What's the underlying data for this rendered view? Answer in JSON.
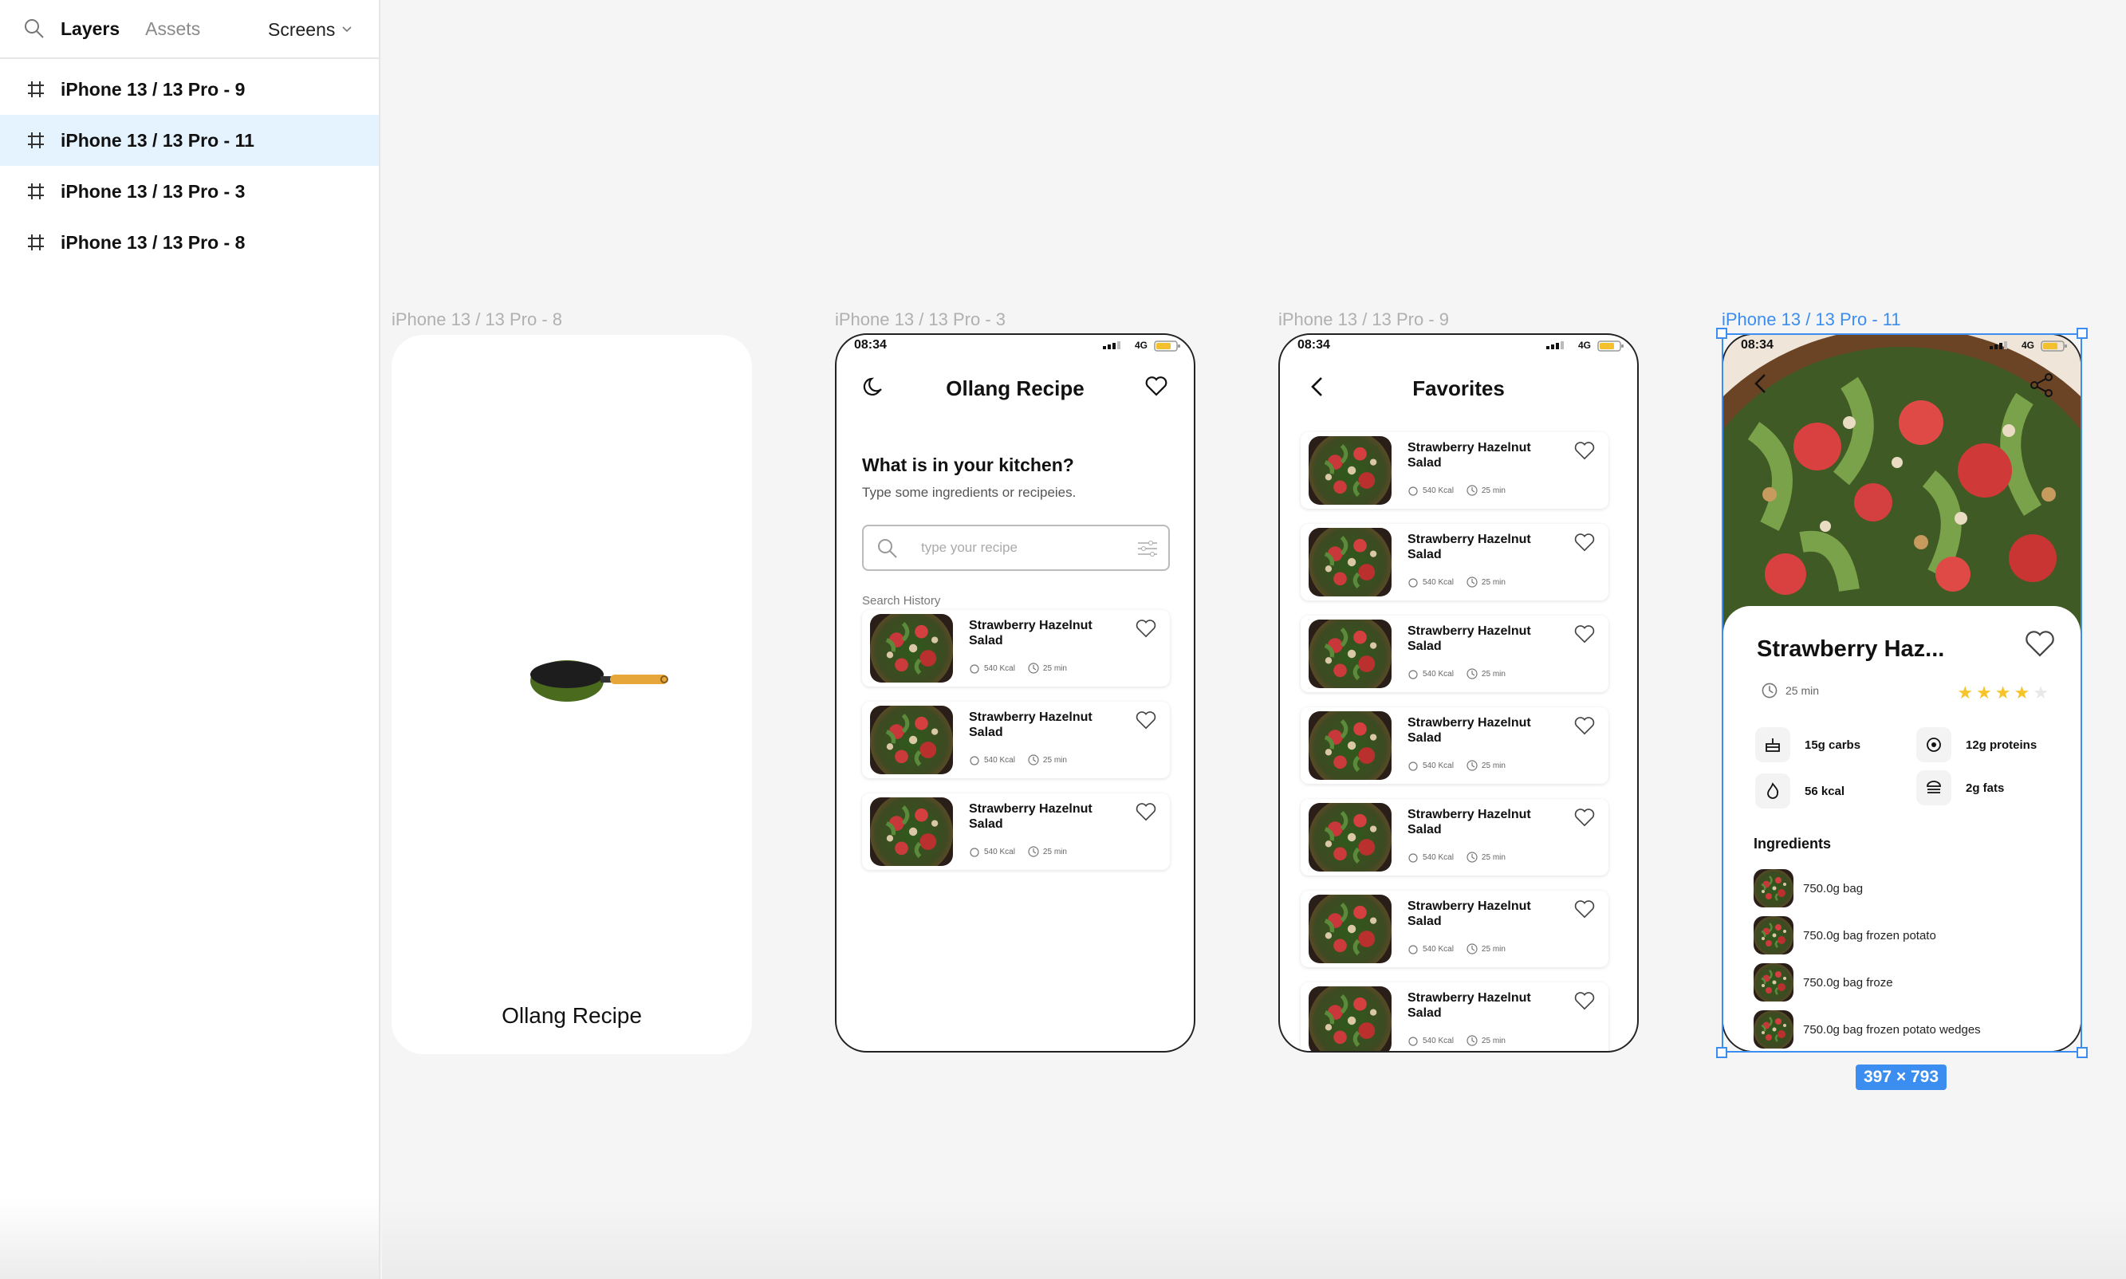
{
  "sidebar": {
    "tabs": [
      "Layers",
      "Assets"
    ],
    "screens_label": "Screens",
    "layers": [
      "iPhone 13 / 13 Pro - 9",
      "iPhone 13 / 13 Pro - 11",
      "iPhone 13 / 13 Pro - 3",
      "iPhone 13 / 13 Pro - 8"
    ]
  },
  "frames": {
    "splash": {
      "label": "iPhone 13 / 13 Pro - 8",
      "title": "Ollang Recipe"
    },
    "home": {
      "label": "iPhone 13 / 13 Pro - 3",
      "time": "08:34",
      "network": "4G",
      "title": "Ollang Recipe",
      "question": "What is in your kitchen?",
      "subtitle": "Type some ingredients or recipeies.",
      "search_placeholder": "type your recipe",
      "history_label": "Search History",
      "cards": [
        {
          "name": "Strawberry Hazelnut Salad",
          "kcal": "540 Kcal",
          "time": "25 min"
        },
        {
          "name": "Strawberry Hazelnut Salad",
          "kcal": "540 Kcal",
          "time": "25 min"
        },
        {
          "name": "Strawberry Hazelnut Salad",
          "kcal": "540 Kcal",
          "time": "25 min"
        }
      ]
    },
    "favorites": {
      "label": "iPhone 13 / 13 Pro - 9",
      "time": "08:34",
      "network": "4G",
      "title": "Favorites",
      "cards": [
        {
          "name": "Strawberry Hazelnut Salad",
          "kcal": "540 Kcal",
          "time": "25 min"
        },
        {
          "name": "Strawberry Hazelnut Salad",
          "kcal": "540 Kcal",
          "time": "25 min"
        },
        {
          "name": "Strawberry Hazelnut Salad",
          "kcal": "540 Kcal",
          "time": "25 min"
        },
        {
          "name": "Strawberry Hazelnut Salad",
          "kcal": "540 Kcal",
          "time": "25 min"
        },
        {
          "name": "Strawberry Hazelnut Salad",
          "kcal": "540 Kcal",
          "time": "25 min"
        },
        {
          "name": "Strawberry Hazelnut Salad",
          "kcal": "540 Kcal",
          "time": "25 min"
        },
        {
          "name": "Strawberry Hazelnut Salad",
          "kcal": "540 Kcal",
          "time": "25 min"
        }
      ]
    },
    "detail": {
      "label": "iPhone 13 / 13 Pro - 11",
      "time": "08:34",
      "network": "4G",
      "title": "Strawberry Haz...",
      "time_label": "25 min",
      "rating": 4,
      "rating_max": 5,
      "nutrition": {
        "carbs": "15g carbs",
        "proteins": "12g proteins",
        "kcal": "56 kcal",
        "fats": "2g fats"
      },
      "ingredients_title": "Ingredients",
      "ingredients": [
        "750.0g bag",
        "750.0g bag frozen potato",
        "750.0g bag froze",
        "750.0g bag frozen potato wedges"
      ],
      "dimensions": "397 × 793"
    }
  },
  "colors": {
    "selection": "#3b8ef0",
    "selected_layer_bg": "#e5f3ff",
    "star": "#f6c329",
    "pan_body": "#4a6b1e",
    "pan_handle": "#e6a63a"
  }
}
